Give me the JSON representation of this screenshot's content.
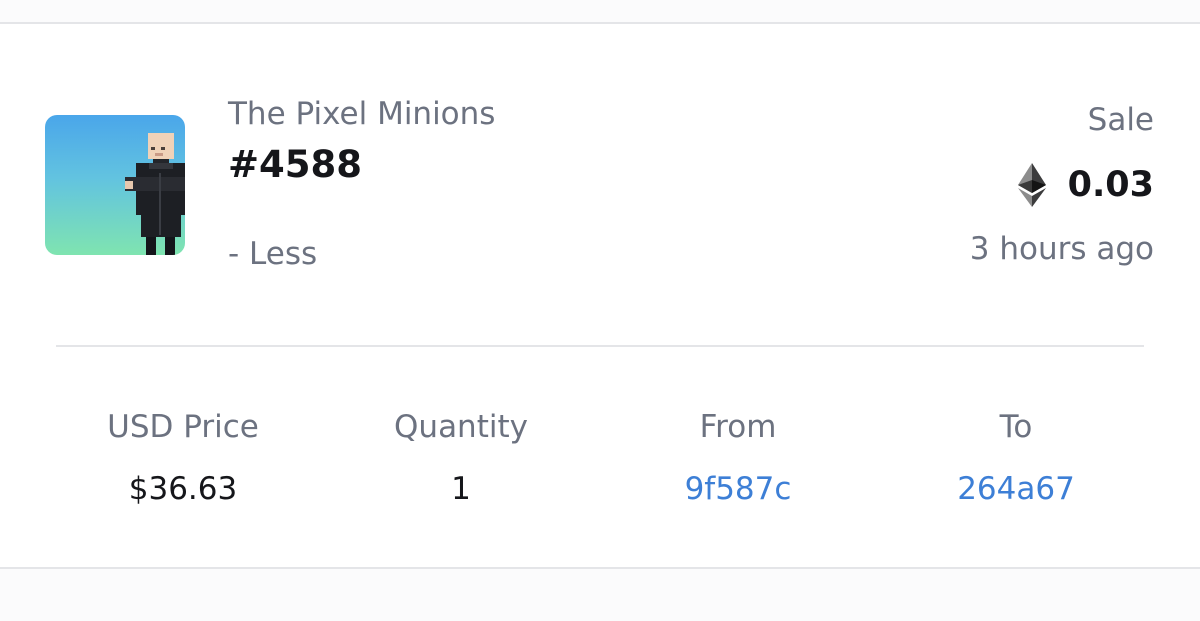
{
  "item": {
    "collection": "The Pixel Minions",
    "token_id": "#4588",
    "toggle_label": "- Less",
    "image_icon": "pixel-minion-avatar"
  },
  "event": {
    "type": "Sale",
    "price": "0.03",
    "currency_icon": "ethereum-icon",
    "time_ago": "3 hours ago"
  },
  "details": {
    "usd_price": {
      "label": "USD Price",
      "value": "$36.63"
    },
    "quantity": {
      "label": "Quantity",
      "value": "1"
    },
    "from": {
      "label": "From",
      "value": "9f587c"
    },
    "to": {
      "label": "To",
      "value": "264a67"
    }
  },
  "colors": {
    "muted_text": "#6c7280",
    "primary_text": "#15161a",
    "link": "#3d7fd6",
    "divider": "#e4e5e8",
    "thumb_gradient_top": "#4aa6ea",
    "thumb_gradient_bottom": "#7fe4b0"
  }
}
